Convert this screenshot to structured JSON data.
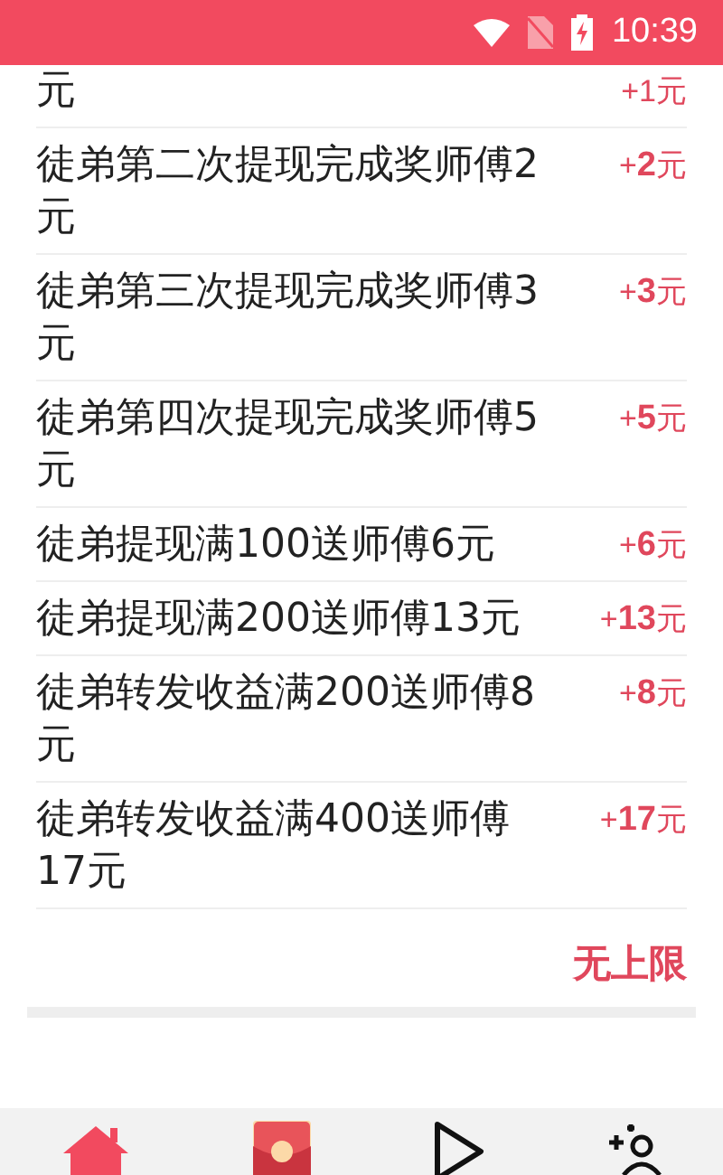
{
  "status_bar": {
    "time": "10:39"
  },
  "rewards": [
    {
      "label": "元",
      "reward": "+1元"
    },
    {
      "label": "徒弟第二次提现完成奖师傅2元",
      "reward": "+**2**元"
    },
    {
      "label": "徒弟第三次提现完成奖师傅3元",
      "reward": "+**3**元"
    },
    {
      "label": "徒弟第四次提现完成奖师傅5元",
      "reward": "+**5**元"
    },
    {
      "label": "徒弟提现满100送师傅6元",
      "reward": "+**6**元"
    },
    {
      "label": "徒弟提现满200送师傅13元",
      "reward": "+**13**元"
    },
    {
      "label": "徒弟转发收益满200送师傅8元",
      "reward": "+**8**元"
    },
    {
      "label": "徒弟转发收益满400送师傅17元",
      "reward": "+**17**元"
    }
  ],
  "footer_note": "无上限",
  "nav": [
    {
      "kind": "home",
      "selected": true
    },
    {
      "kind": "envelope",
      "selected": false
    },
    {
      "kind": "play",
      "selected": false
    },
    {
      "kind": "invite",
      "selected": false
    }
  ]
}
